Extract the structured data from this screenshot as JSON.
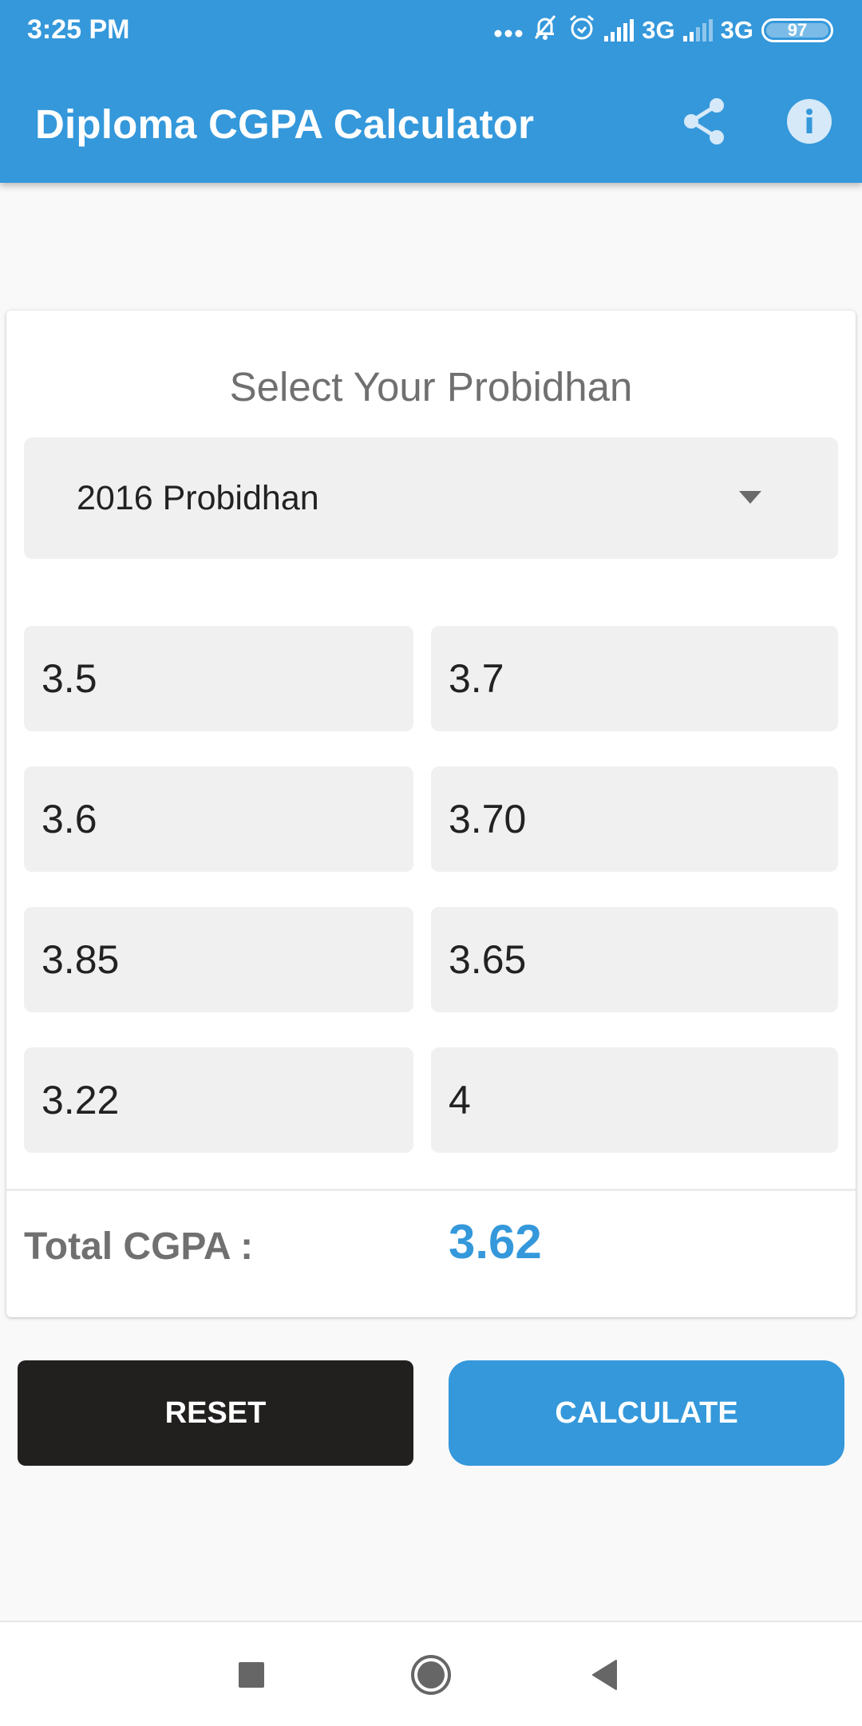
{
  "status_bar": {
    "time": "3:25 PM",
    "network_1": "3G",
    "network_2": "3G",
    "battery": "97",
    "icons": [
      "more-dots-icon",
      "muted-bell-icon",
      "alarm-icon",
      "signal-icon",
      "signal-icon",
      "battery-icon"
    ]
  },
  "app_bar": {
    "title": "Diploma CGPA Calculator",
    "actions": [
      "share-icon",
      "info-icon"
    ]
  },
  "colors": {
    "primary": "#3498db",
    "reset_button": "#221f1f",
    "result": "#3498db"
  },
  "form": {
    "title": "Select Your Probidhan",
    "probidhan_selected": "2016 Probidhan",
    "semester_gpas": [
      "3.5",
      "3.7",
      "3.6",
      "3.70",
      "3.85",
      "3.65",
      "3.22",
      "4"
    ]
  },
  "result": {
    "label": "Total CGPA :",
    "value": "3.62"
  },
  "buttons": {
    "reset": "RESET",
    "calculate": "CALCULATE"
  },
  "nav_bar": {
    "items": [
      "recents-icon",
      "home-icon",
      "back-icon"
    ]
  }
}
